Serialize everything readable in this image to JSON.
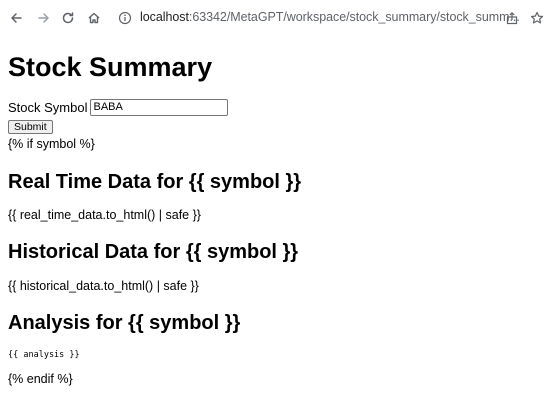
{
  "browser": {
    "url_host": "localhost",
    "url_rest": ":63342/MetaGPT/workspace/stock_summary/stock_summ..."
  },
  "page": {
    "title": "Stock Summary",
    "symbol_label": "Stock Symbol",
    "symbol_value": "BABA",
    "submit_label": "Submit",
    "if_tag": "{% if symbol %}",
    "real_time_heading": "Real Time Data for {{ symbol }}",
    "real_time_body": "{{ real_time_data.to_html() | safe }}",
    "historical_heading": "Historical Data for {{ symbol }}",
    "historical_body": "{{ historical_data.to_html() | safe }}",
    "analysis_heading": "Analysis for {{ symbol }}",
    "analysis_body": "{{ analysis }}",
    "endif_tag": "{% endif %}"
  }
}
